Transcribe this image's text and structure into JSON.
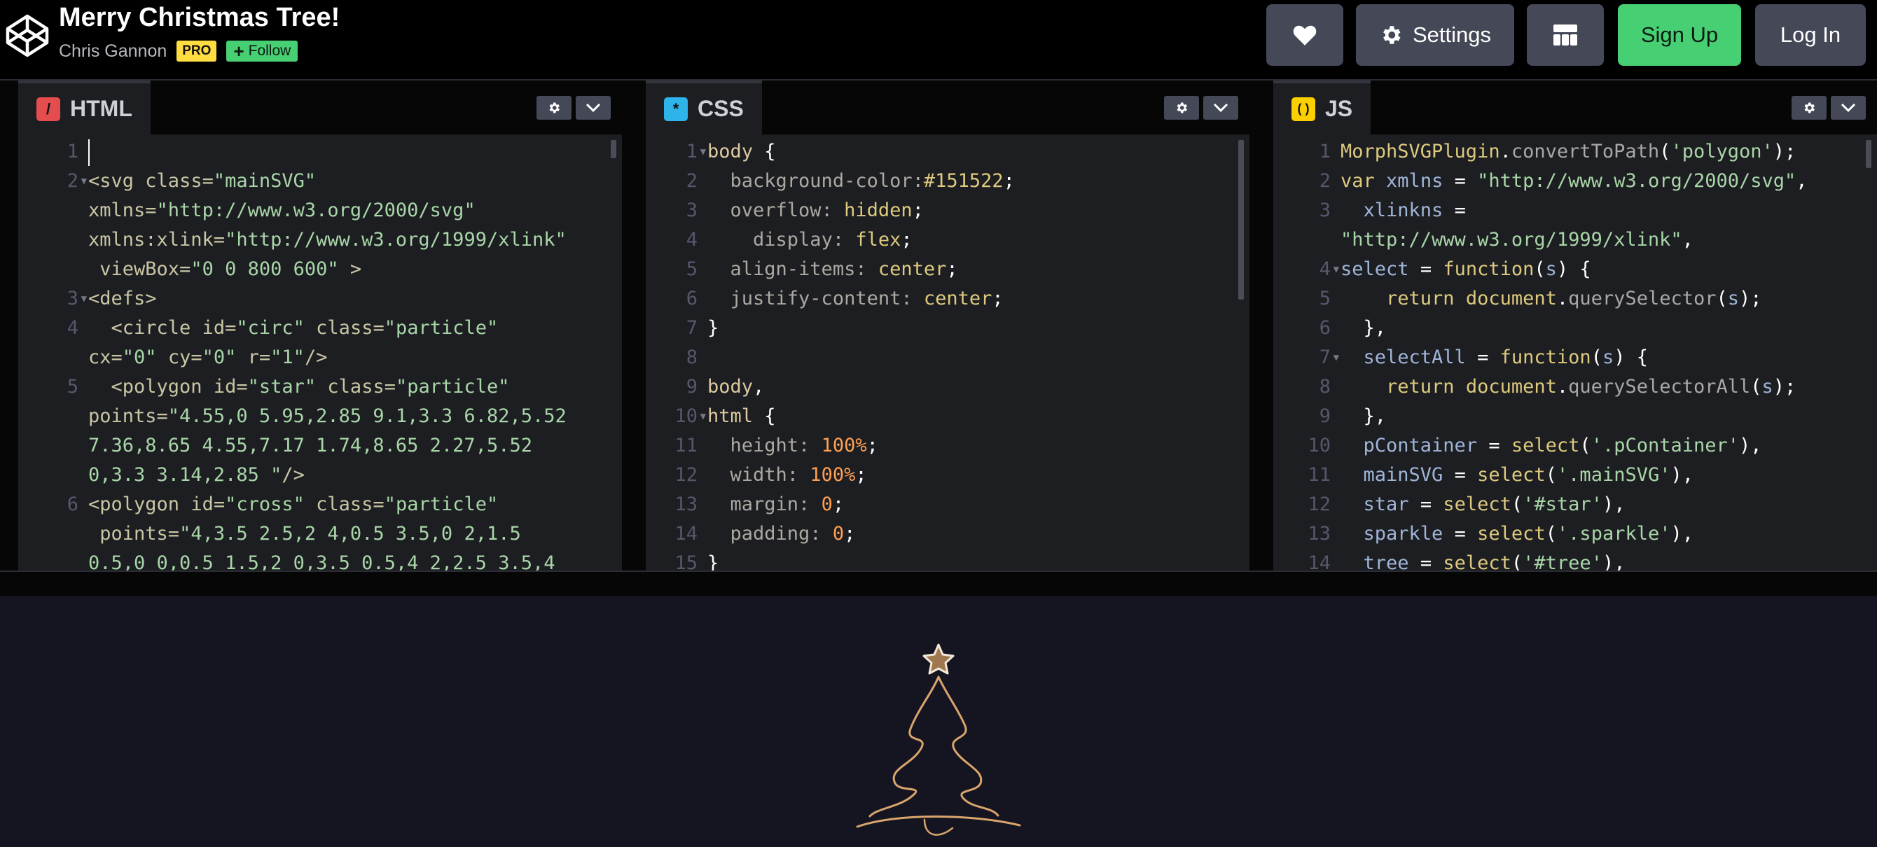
{
  "header": {
    "title": "Merry Christmas Tree!",
    "author": "Chris Gannon",
    "pro_badge": "PRO",
    "follow_label": "Follow",
    "settings_label": "Settings",
    "signup_label": "Sign Up",
    "login_label": "Log In"
  },
  "editors": {
    "html": {
      "label": "HTML",
      "icon": "/"
    },
    "css": {
      "label": "CSS",
      "icon": "*"
    },
    "js": {
      "label": "JS",
      "icon": "( )"
    }
  },
  "colors": {
    "background": "#000000",
    "editor_bg": "#1d1e22",
    "preview_bg": "#151522",
    "signup_green": "#47cf73",
    "pro_yellow": "#ffdd40",
    "html_icon": "#e44d4d",
    "css_icon": "#2fb4ea",
    "js_icon": "#fcd000",
    "tree_gold": "#d9a56c"
  },
  "icons": [
    "codepen-logo-icon",
    "heart-icon",
    "gear-icon",
    "layout-grid-icon",
    "chevron-down-icon",
    "star-icon",
    "tree-icon"
  ]
}
